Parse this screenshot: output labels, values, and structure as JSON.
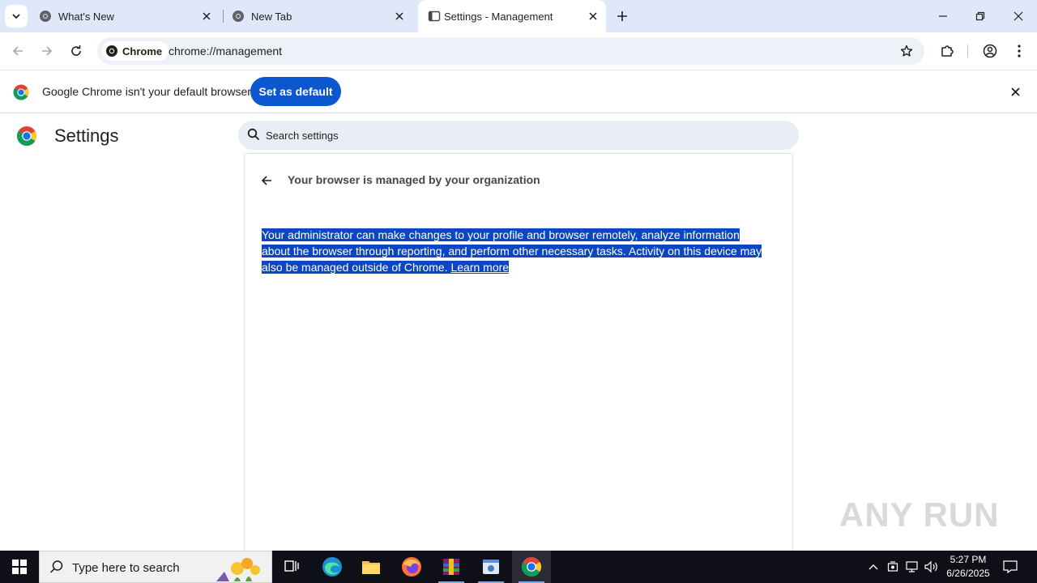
{
  "browser": {
    "tabs": [
      {
        "label": "What's New",
        "active": false
      },
      {
        "label": "New Tab",
        "active": false
      },
      {
        "label": "Settings - Management",
        "active": true
      }
    ],
    "omnibox": {
      "chip_label": "Chrome",
      "url": "chrome://management"
    }
  },
  "infobar": {
    "message": "Google Chrome isn't your default browser",
    "button_label": "Set as default"
  },
  "settings": {
    "title": "Settings",
    "search_placeholder": "Search settings",
    "card": {
      "title": "Your browser is managed by your organization",
      "body": "Your administrator can make changes to your profile and browser remotely, analyze information about the browser through reporting, and perform other necessary tasks. Activity on this device may also be managed outside of Chrome.",
      "link": "Learn more"
    }
  },
  "watermark": "ANY RUN",
  "taskbar": {
    "search_placeholder": "Type here to search",
    "clock_time": "5:27 PM",
    "clock_date": "6/26/2025"
  },
  "colors": {
    "accent": "#0b57d0",
    "tabstrip": "#dfe8f8",
    "selection": "#0b46c3",
    "taskbar": "#0f0f18"
  }
}
